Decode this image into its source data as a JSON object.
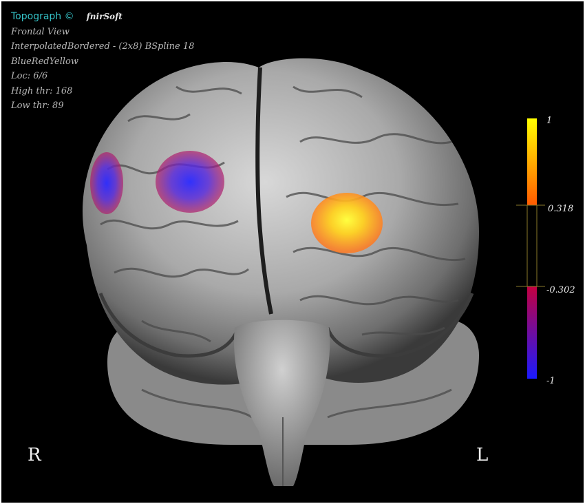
{
  "header": {
    "app_name": "Topograph ©",
    "vendor": "fnirSoft",
    "view": "Frontal View",
    "interpolation": "InterpolatedBordered - (2x8) BSpline 18",
    "colormap": "BlueRedYellow",
    "loc": "Loc:  6/6",
    "high_thr": "High thr:  168",
    "low_thr": "Low thr:  89"
  },
  "colorbar": {
    "max_label": "1",
    "upper_threshold_label": "0.318",
    "lower_threshold_label": "-0.302",
    "min_label": "-1",
    "max_value": 1,
    "upper_threshold": 0.318,
    "lower_threshold": -0.302,
    "min_value": -1,
    "colors": {
      "yellow": "#ffff00",
      "orange": "#ff5a00",
      "red": "#c40040",
      "blue": "#1a1aff",
      "middle": "#000000",
      "line": "#8a7a2a"
    }
  },
  "side_labels": {
    "right": "R",
    "left": "L"
  },
  "activations": [
    {
      "id": "blob-1",
      "type": "negative"
    },
    {
      "id": "blob-2",
      "type": "negative"
    },
    {
      "id": "blob-3",
      "type": "positive"
    }
  ]
}
